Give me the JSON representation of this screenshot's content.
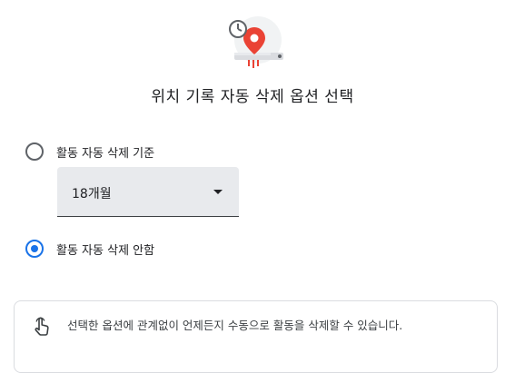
{
  "title": "위치 기록 자동 삭제 옵션 선택",
  "options": [
    {
      "label": "활동 자동 삭제 기준",
      "selected": false
    },
    {
      "label": "활동 자동 삭제 안함",
      "selected": true
    }
  ],
  "dropdown": {
    "value": "18개월"
  },
  "info": {
    "text": "선택한 옵션에 관계없이 언제든지 수동으로 활동을 삭제할 수 있습니다."
  },
  "colors": {
    "accent": "#1a73e8",
    "brand_red": "#ea4335"
  },
  "icons": {
    "hero": "location-history-clock-icon",
    "info": "hand-touch-icon"
  }
}
